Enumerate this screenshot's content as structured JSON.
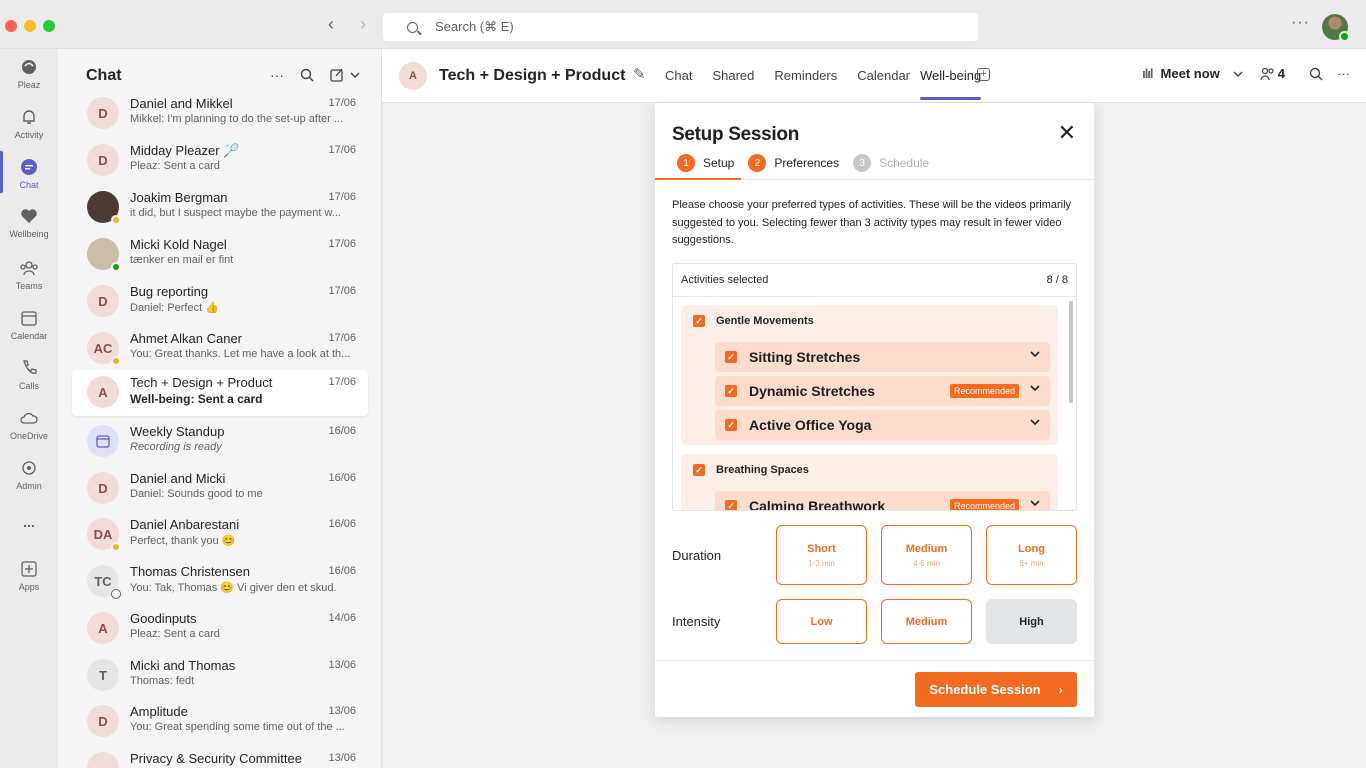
{
  "search": {
    "placeholder": "Search (⌘ E)"
  },
  "rail": {
    "items": [
      {
        "label": "Pleaz",
        "icon": "pleaz-icon"
      },
      {
        "label": "Activity",
        "icon": "bell-icon"
      },
      {
        "label": "Chat",
        "icon": "chat-icon"
      },
      {
        "label": "Wellbeing",
        "icon": "heart-icon"
      },
      {
        "label": "Teams",
        "icon": "teams-icon"
      },
      {
        "label": "Calendar",
        "icon": "calendar-icon"
      },
      {
        "label": "Calls",
        "icon": "phone-icon"
      },
      {
        "label": "OneDrive",
        "icon": "cloud-icon"
      },
      {
        "label": "Admin",
        "icon": "admin-icon"
      },
      {
        "label": "...",
        "icon": "more-icon"
      },
      {
        "label": "Apps",
        "icon": "apps-icon"
      }
    ]
  },
  "chat_panel": {
    "title": "Chat",
    "items": [
      {
        "name": "Daniel and Mikkel",
        "time": "17/06",
        "preview": "Mikkel: I'm planning to do the set-up after ...",
        "avatar": "D"
      },
      {
        "name": "Midday Pleazer 🏸",
        "time": "17/06",
        "preview": "Pleaz: Sent a card",
        "avatar": "D"
      },
      {
        "name": "Joakim Bergman",
        "time": "17/06",
        "preview": "it did, but I suspect maybe the payment w...",
        "avatar": ""
      },
      {
        "name": "Micki Kold Nagel",
        "time": "17/06",
        "preview": "tænker en mail er fint",
        "avatar": ""
      },
      {
        "name": "Bug reporting",
        "time": "17/06",
        "preview": "Daniel: Perfect 👍",
        "avatar": "D"
      },
      {
        "name": "Ahmet Alkan Caner",
        "time": "17/06",
        "preview": "You: Great thanks. Let me have a look at th...",
        "avatar": "AC"
      },
      {
        "name": "Tech + Design + Product",
        "time": "17/06",
        "preview": "Well-being: Sent a card",
        "avatar": "A"
      },
      {
        "name": "Weekly Standup",
        "time": "16/06",
        "preview": "Recording is ready",
        "avatar": ""
      },
      {
        "name": "Daniel and Micki",
        "time": "16/06",
        "preview": "Daniel: Sounds good to me",
        "avatar": "D"
      },
      {
        "name": "Daniel Anbarestani",
        "time": "16/06",
        "preview": "Perfect, thank you 😊",
        "avatar": "DA"
      },
      {
        "name": "Thomas Christensen",
        "time": "16/06",
        "preview": "You: Tak, Thomas 😊 Vi giver den et skud.",
        "avatar": "TC"
      },
      {
        "name": "Goodinputs",
        "time": "14/06",
        "preview": "Pleaz: Sent a card",
        "avatar": "A"
      },
      {
        "name": "Micki and Thomas",
        "time": "13/06",
        "preview": "Thomas: fedt",
        "avatar": "T"
      },
      {
        "name": "Amplitude",
        "time": "13/06",
        "preview": "You: Great spending some time out of the ...",
        "avatar": "D"
      },
      {
        "name": "Privacy & Security Committee",
        "time": "13/06",
        "preview": "",
        "avatar": ""
      }
    ]
  },
  "channel": {
    "avatar": "A",
    "title": "Tech + Design + Product",
    "tabs": [
      "Chat",
      "Shared",
      "Reminders",
      "Calendar",
      "Well-being"
    ],
    "meet_now": "Meet now",
    "participants": "4"
  },
  "modal": {
    "title": "Setup Session",
    "steps": [
      {
        "num": "1",
        "label": "Setup"
      },
      {
        "num": "2",
        "label": "Preferences"
      },
      {
        "num": "3",
        "label": "Schedule"
      }
    ],
    "description": "Please choose your preferred types of activities. These will be the videos primarily suggested to you. Selecting fewer than 3 activity types may result in fewer video suggestions.",
    "activities_label": "Activities selected",
    "activities_count": "8 / 8",
    "groups": [
      {
        "name": "Gentle Movements",
        "items": [
          {
            "label": "Sitting Stretches",
            "recommended": ""
          },
          {
            "label": "Dynamic Stretches",
            "recommended": "Recommended"
          },
          {
            "label": "Active Office Yoga",
            "recommended": ""
          }
        ]
      },
      {
        "name": "Breathing Spaces",
        "items": [
          {
            "label": "Calming Breathwork",
            "recommended": "Recommended"
          }
        ]
      }
    ],
    "duration_label": "Duration",
    "duration_options": [
      {
        "label": "Short",
        "sub": "1-3 min"
      },
      {
        "label": "Medium",
        "sub": "4-6 min"
      },
      {
        "label": "Long",
        "sub": "6+ min"
      }
    ],
    "intensity_label": "Intensity",
    "intensity_options": [
      "Low",
      "Medium",
      "High"
    ],
    "intensity_selected": "High",
    "schedule_button": "Schedule Session"
  },
  "colors": {
    "accent": "#f26b21",
    "teams_purple": "#5b5fc7"
  }
}
